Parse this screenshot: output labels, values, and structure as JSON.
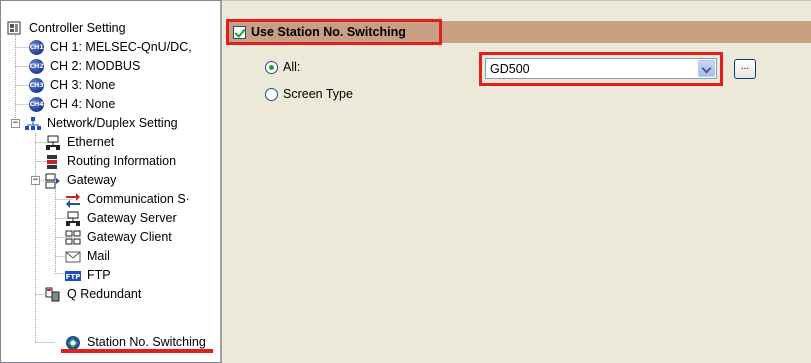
{
  "tree": {
    "items": [
      {
        "label": "Controller Setting",
        "icon": "controller-setting-icon"
      },
      {
        "label": "CH 1: MELSEC-QnU/DC,",
        "icon": "ch1-badge-icon",
        "badge": "CH1"
      },
      {
        "label": "CH 2: MODBUS",
        "icon": "ch2-badge-icon",
        "badge": "CH2"
      },
      {
        "label": "CH 3: None",
        "icon": "ch3-badge-icon",
        "badge": "CH3"
      },
      {
        "label": "CH 4: None",
        "icon": "ch4-badge-icon",
        "badge": "CH4"
      },
      {
        "label": "Network/Duplex Setting",
        "icon": "network-icon"
      },
      {
        "label": "Ethernet",
        "icon": "ethernet-icon"
      },
      {
        "label": "Routing Information",
        "icon": "routing-icon"
      },
      {
        "label": "Gateway",
        "icon": "gateway-icon"
      },
      {
        "label": "Communication S·",
        "icon": "communication-icon"
      },
      {
        "label": "Gateway Server",
        "icon": "gateway-server-icon"
      },
      {
        "label": "Gateway Client",
        "icon": "gateway-client-icon"
      },
      {
        "label": "Mail",
        "icon": "mail-icon"
      },
      {
        "label": "FTP",
        "icon": "ftp-icon",
        "badge": "FTP"
      },
      {
        "label": "Q Redundant",
        "icon": "q-redundant-icon"
      },
      {
        "label": "Station No. Switching",
        "icon": "station-switching-icon",
        "selected": true
      }
    ],
    "expander_minus": "−"
  },
  "settings": {
    "use_station_switching_label": "Use Station No. Switching",
    "use_station_switching_checked": true,
    "radio_all_label": "All:",
    "radio_screen_type_label": "Screen Type",
    "selected_radio": "All",
    "station_combo_value": "GD500",
    "browse_button_label": "..."
  },
  "colors": {
    "highlight_red": "#e0201e",
    "band_brown": "#c99f83",
    "panel_bg": "#ece9d8",
    "check_green": "#21a121"
  }
}
